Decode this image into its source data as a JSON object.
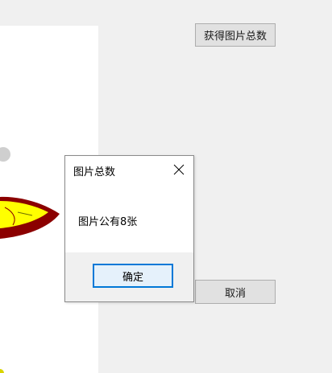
{
  "toolbar": {
    "get_count_label": "获得图片总数",
    "cancel_label": "取消"
  },
  "dialog": {
    "title": "图片总数",
    "message": "图片公有8张",
    "ok_label": "确定",
    "close_icon": "close-icon"
  },
  "colors": {
    "accent": "#0078d7",
    "button_face": "#e1e1e1",
    "picture_yellow": "#ffff00",
    "picture_darkred": "#8b0000"
  }
}
